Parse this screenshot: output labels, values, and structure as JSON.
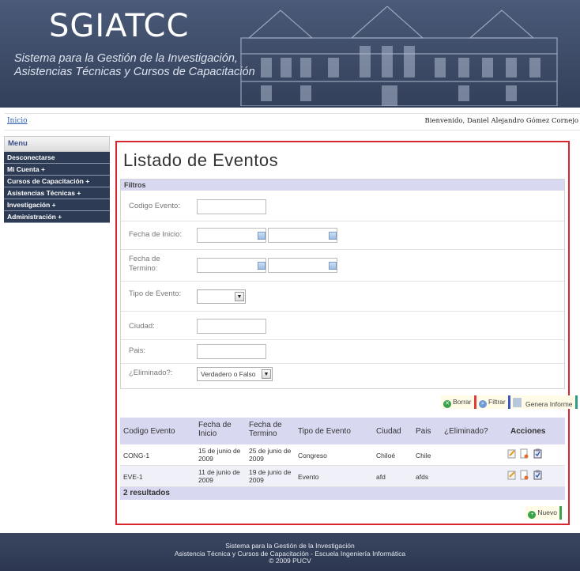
{
  "header": {
    "logo": "SGIATCC",
    "subtitle": "Sistema para la Gestión de la Investigación, Asistencias Técnicas y Cursos de Capacitación"
  },
  "breadcrumb": {
    "home": "Inicio"
  },
  "welcome": "Bienvenido, Daniel Alejandro Gómez Cornejo",
  "menu": {
    "title": "Menu",
    "items": [
      {
        "label": "Desconectarse"
      },
      {
        "label": "Mi Cuenta +"
      },
      {
        "label": "Cursos de Capacitación +"
      },
      {
        "label": "Asistencias Técnicas +"
      },
      {
        "label": "Investigación +"
      },
      {
        "label": "Administración +"
      }
    ]
  },
  "main": {
    "title": "Listado de Eventos",
    "filters": {
      "heading": "Filtros",
      "codigo_label": "Codigo Evento:",
      "fecha_inicio_label": "Fecha de Inicio:",
      "fecha_termino_label": "Fecha de Termino:",
      "tipo_label": "Tipo de Evento:",
      "tipo_value": "",
      "ciudad_label": "Ciudad:",
      "pais_label": "Pais:",
      "eliminado_label": "¿Eliminado?:",
      "eliminado_value": "Verdadero o Falso"
    },
    "actions": {
      "borrar": "Borrar",
      "filtrar": "Filtrar",
      "informe": "Genera Informe"
    },
    "table": {
      "columns": [
        "Codigo Evento",
        "Fecha de Inicio",
        "Fecha de Termino",
        "Tipo de Evento",
        "Ciudad",
        "Pais",
        "¿Eliminado?",
        "Acciones"
      ],
      "rows": [
        {
          "codigo": "CONG-1",
          "inicio": "15 de junio de 2009",
          "termino": "25 de junio de 2009",
          "tipo": "Congreso",
          "ciudad": "Chiloé",
          "pais": "Chile",
          "eliminado": ""
        },
        {
          "codigo": "EVE-1",
          "inicio": "11 de junio de 2009",
          "termino": "19 de junio de 2009",
          "tipo": "Evento",
          "ciudad": "afd",
          "pais": "afds",
          "eliminado": ""
        }
      ],
      "count": "2 resultados"
    },
    "nuevo": "Nuevo"
  },
  "footer": {
    "line1": "Sistema para la Gestión de la Investigación",
    "line2": "Asistencia Técnica y Cursos de Capacitación - Escuela Ingeniería Informática",
    "line3": "© 2009 PUCV"
  },
  "colors": {
    "header_bg": "#3c4a66",
    "menu_bg": "#2e3b55",
    "highlight_border": "#d9262e",
    "table_header_bg": "#d8d9f0"
  }
}
